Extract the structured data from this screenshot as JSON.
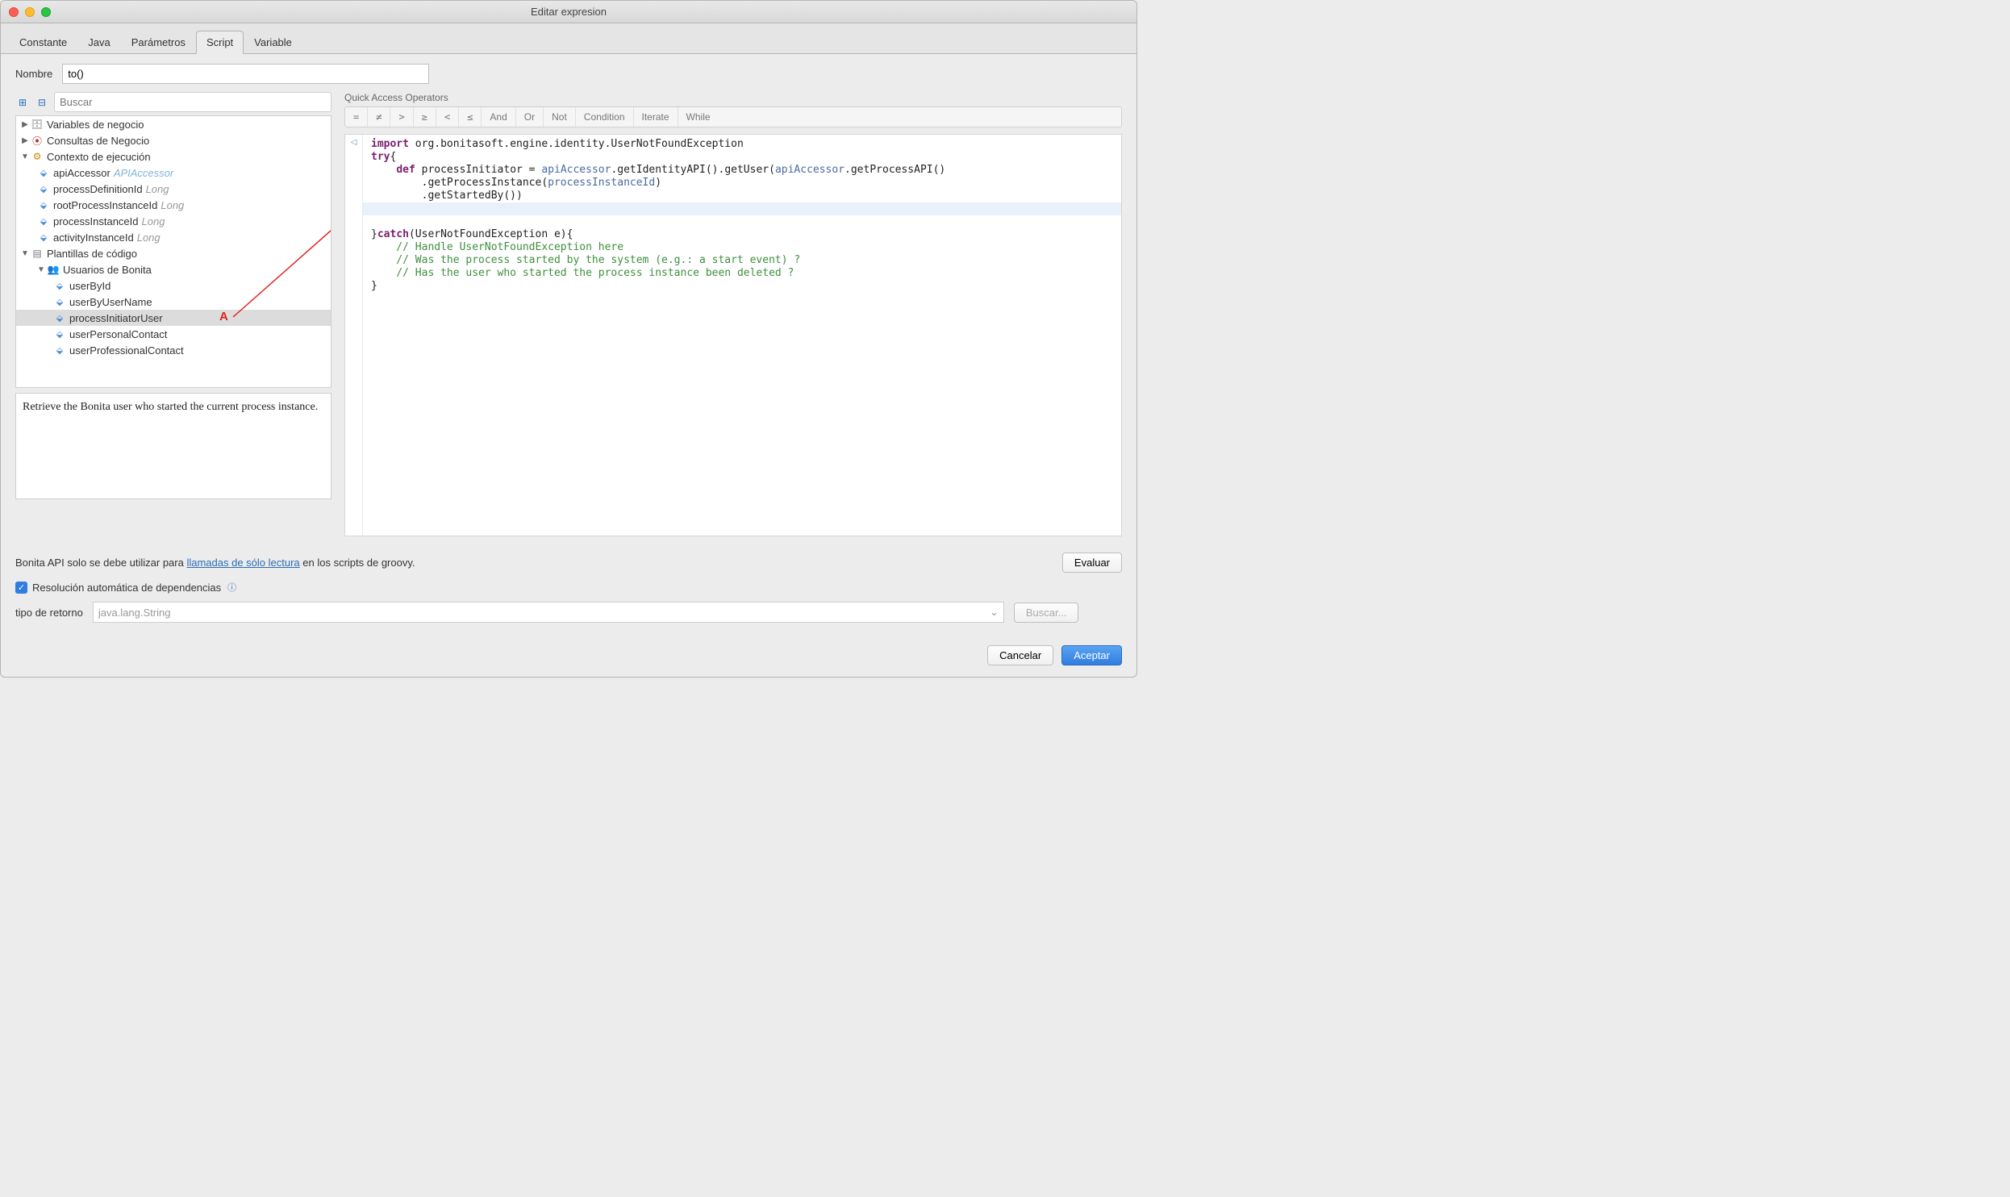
{
  "window": {
    "title": "Editar expresion"
  },
  "tabs": {
    "items": [
      "Constante",
      "Java",
      "Parámetros",
      "Script",
      "Variable"
    ],
    "activeIndex": 3
  },
  "nameField": {
    "label": "Nombre",
    "value": "to()"
  },
  "treeSearch": {
    "placeholder": "Buscar"
  },
  "tree": {
    "root1": "Variables de negocio",
    "root2": "Consultas de Negocio",
    "root3": "Contexto de ejecución",
    "ctx": {
      "apiAccessor": {
        "name": "apiAccessor",
        "type": "APIAccessor"
      },
      "processDefinitionId": {
        "name": "processDefinitionId",
        "type": "Long"
      },
      "rootProcessInstanceId": {
        "name": "rootProcessInstanceId",
        "type": "Long"
      },
      "processInstanceId": {
        "name": "processInstanceId",
        "type": "Long"
      },
      "activityInstanceId": {
        "name": "activityInstanceId",
        "type": "Long"
      }
    },
    "root4": "Plantillas de código",
    "grp": "Usuarios de Bonita",
    "users": {
      "u1": "userById",
      "u2": "userByUserName",
      "u3": "processInitiatorUser",
      "u4": "userPersonalContact",
      "u5": "userProfessionalContact"
    }
  },
  "description": "Retrieve the Bonita user who started the current process instance.",
  "qa": {
    "label": "Quick Access Operators",
    "ops": [
      "=",
      "≠",
      ">",
      "≥",
      "<",
      "≤",
      "And",
      "Or",
      "Not",
      "Condition",
      "Iterate",
      "While"
    ]
  },
  "code": {
    "l1a": "import",
    "l1b": " org.bonitasoft.engine.identity.UserNotFoundException",
    "l2a": "try",
    "l2b": "{",
    "l3a": "    ",
    "l3b": "def",
    "l3c": " processInitiator = ",
    "l3d": "apiAccessor",
    "l3e": ".getIdentityAPI().getUser(",
    "l3f": "apiAccessor",
    "l3g": ".getProcessAPI()",
    "l4": "        .getProcessInstance(",
    "l4b": "processInstanceId",
    "l4c": ")",
    "l5": "        .getStartedBy())",
    "l6": "",
    "l7a": "}",
    "l7b": "catch",
    "l7c": "(UserNotFoundException e){",
    "l8": "    // Handle UserNotFoundException here",
    "l9": "    // Was the process started by the system (e.g.: a start event) ?",
    "l10": "    // Has the user who started the process instance been deleted ?",
    "l11": "}"
  },
  "bottom": {
    "apiNote1": "Bonita API solo se debe utilizar para ",
    "apiLink": "llamadas de sólo lectura",
    "apiNote2": " en los scripts de groovy.",
    "evaluate": "Evaluar",
    "autoDep": "Resolución automática de dependencias",
    "returnTypeLabel": "tipo de retorno",
    "returnTypeValue": "java.lang.String",
    "searchBtn": "Buscar...",
    "cancel": "Cancelar",
    "accept": "Aceptar"
  },
  "annotation": "A"
}
